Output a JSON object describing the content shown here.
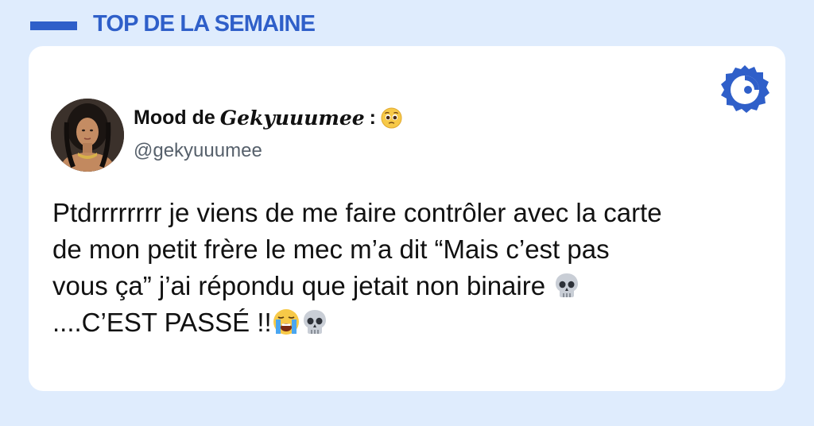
{
  "header": {
    "label": "TOP DE LA SEMAINE"
  },
  "brand": {
    "icon": "brand-logo-icon",
    "color": "#2f5fc9"
  },
  "tweet": {
    "author": {
      "name_prefix": "Mood de",
      "name_styled": "𝑮𝒆𝒌𝒚𝒖𝒖𝒖𝒎𝒆𝒆",
      "name_suffix": ":",
      "name_emoji": "pleading-face-icon",
      "handle": "@gekyuuumee"
    },
    "lines": [
      "Ptdrrrrrrrr je viens de me faire contrôler avec la carte",
      "de mon petit frère le mec m’a dit “Mais c’est pas",
      "vous ça” j’ai répondu que jetait non binaire",
      "....C’EST PASSÉ !!"
    ],
    "emojis": [
      "skull-icon",
      "loudly-crying-face-icon",
      "skull-icon"
    ]
  }
}
